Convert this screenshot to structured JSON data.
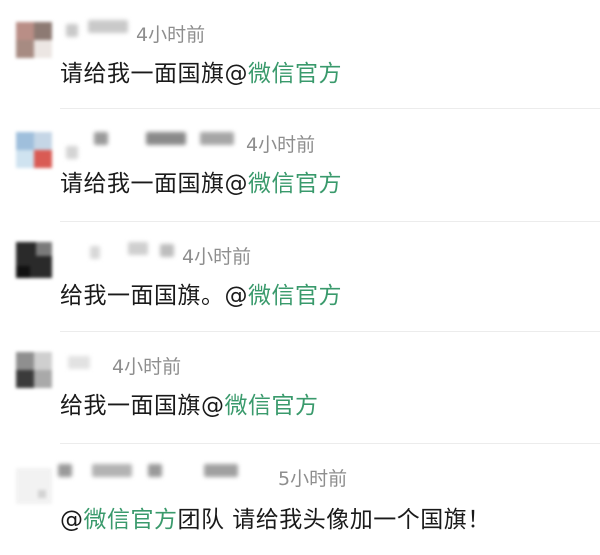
{
  "comments": [
    {
      "time": "4小时前",
      "pre": "请给我一面国旗",
      "at": "@",
      "mention": "微信官方",
      "post": ""
    },
    {
      "time": "4小时前",
      "pre": "请给我一面国旗",
      "at": "@",
      "mention": "微信官方",
      "post": ""
    },
    {
      "time": "4小时前",
      "pre": "给我一面国旗。",
      "at": "@",
      "mention": "微信官方",
      "post": ""
    },
    {
      "time": "4小时前",
      "pre": "给我一面国旗",
      "at": "@",
      "mention": "微信官方",
      "post": ""
    },
    {
      "time": "5小时前",
      "pre": "",
      "at": "@",
      "mention": "微信官方",
      "post": "团队 请给我头像加一个国旗！"
    }
  ],
  "colors": {
    "mention": "#3a9a6c",
    "time": "#8e8e8e",
    "text": "#1a1a1a"
  }
}
